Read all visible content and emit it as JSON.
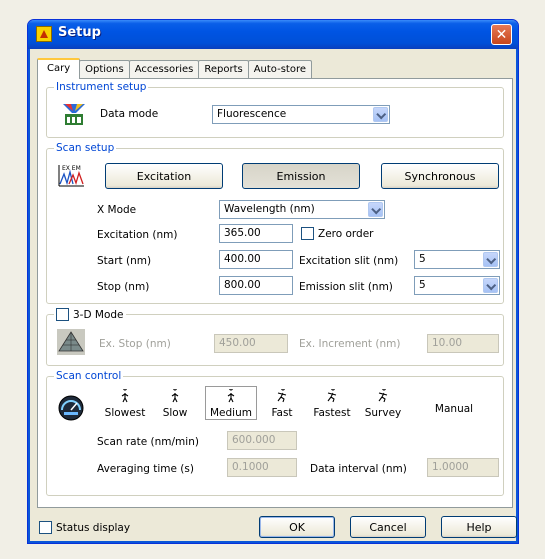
{
  "window": {
    "title": "Setup",
    "close_glyph": "✕"
  },
  "tabs": [
    "Cary",
    "Options",
    "Accessories",
    "Reports",
    "Auto-store"
  ],
  "instrument_setup": {
    "title": "Instrument setup",
    "data_mode_label": "Data mode",
    "data_mode_value": "Fluorescence"
  },
  "scan_setup": {
    "title": "Scan setup",
    "icon_label": "EX EM",
    "buttons": {
      "excitation": "Excitation",
      "emission": "Emission",
      "synchronous": "Synchronous"
    },
    "x_mode_label": "X Mode",
    "x_mode_value": "Wavelength (nm)",
    "excitation_label": "Excitation (nm)",
    "excitation_value": "365.00",
    "zero_order_label": "Zero order",
    "start_label": "Start (nm)",
    "start_value": "400.00",
    "excitation_slit_label": "Excitation slit (nm)",
    "excitation_slit_value": "5",
    "stop_label": "Stop (nm)",
    "stop_value": "800.00",
    "emission_slit_label": "Emission slit (nm)",
    "emission_slit_value": "5"
  },
  "mode_3d": {
    "title": "3-D Mode",
    "ex_stop_label": "Ex. Stop (nm)",
    "ex_stop_value": "450.00",
    "ex_increment_label": "Ex. Increment (nm)",
    "ex_increment_value": "10.00"
  },
  "scan_control": {
    "title": "Scan control",
    "speeds": [
      "Slowest",
      "Slow",
      "Medium",
      "Fast",
      "Fastest",
      "Survey",
      "Manual"
    ],
    "selected_speed": "Medium",
    "scan_rate_label": "Scan rate (nm/min)",
    "scan_rate_value": "600.000",
    "averaging_time_label": "Averaging time (s)",
    "averaging_time_value": "0.1000",
    "data_interval_label": "Data interval (nm)",
    "data_interval_value": "1.0000"
  },
  "footer": {
    "status_display_label": "Status display",
    "ok_label": "OK",
    "cancel_label": "Cancel",
    "help_label": "Help"
  },
  "colors": {
    "title_bar": "#0054e3",
    "group_title": "#0046d5",
    "close_button": "#c7451c",
    "active_tab_accent": "#ffc83c"
  }
}
